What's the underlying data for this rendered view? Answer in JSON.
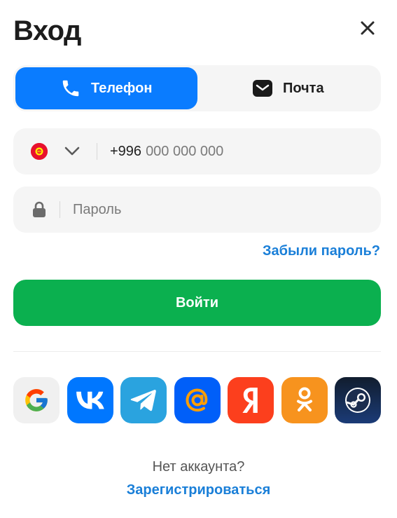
{
  "header": {
    "title": "Вход",
    "close_icon": "close-icon"
  },
  "tabs": [
    {
      "label": "Телефон",
      "icon": "phone-icon",
      "active": true
    },
    {
      "label": "Почта",
      "icon": "mail-icon",
      "active": false
    }
  ],
  "phone_field": {
    "country_icon": "kyrgyzstan-flag-icon",
    "country_code": "+996",
    "placeholder": "000 000 000"
  },
  "password_field": {
    "icon": "lock-icon",
    "placeholder": "Пароль"
  },
  "forgot_password": "Забыли пароль?",
  "login_button": "Войти",
  "socials": [
    {
      "name": "google",
      "color": "#f0f0f0"
    },
    {
      "name": "vk",
      "color": "#0077ff"
    },
    {
      "name": "telegram",
      "color": "#2aa3df"
    },
    {
      "name": "mailru",
      "color": "#005ff9"
    },
    {
      "name": "yandex",
      "color": "#fc3f1d"
    },
    {
      "name": "odnoklassniki",
      "color": "#f7931e"
    },
    {
      "name": "steam",
      "color": "#1b2838"
    }
  ],
  "footer": {
    "no_account": "Нет аккаунта?",
    "register": "Зарегистрироваться"
  },
  "colors": {
    "accent_blue": "#0a7cff",
    "link_blue": "#1a7fd8",
    "login_green": "#0bb04f",
    "field_bg": "#f5f5f5"
  }
}
